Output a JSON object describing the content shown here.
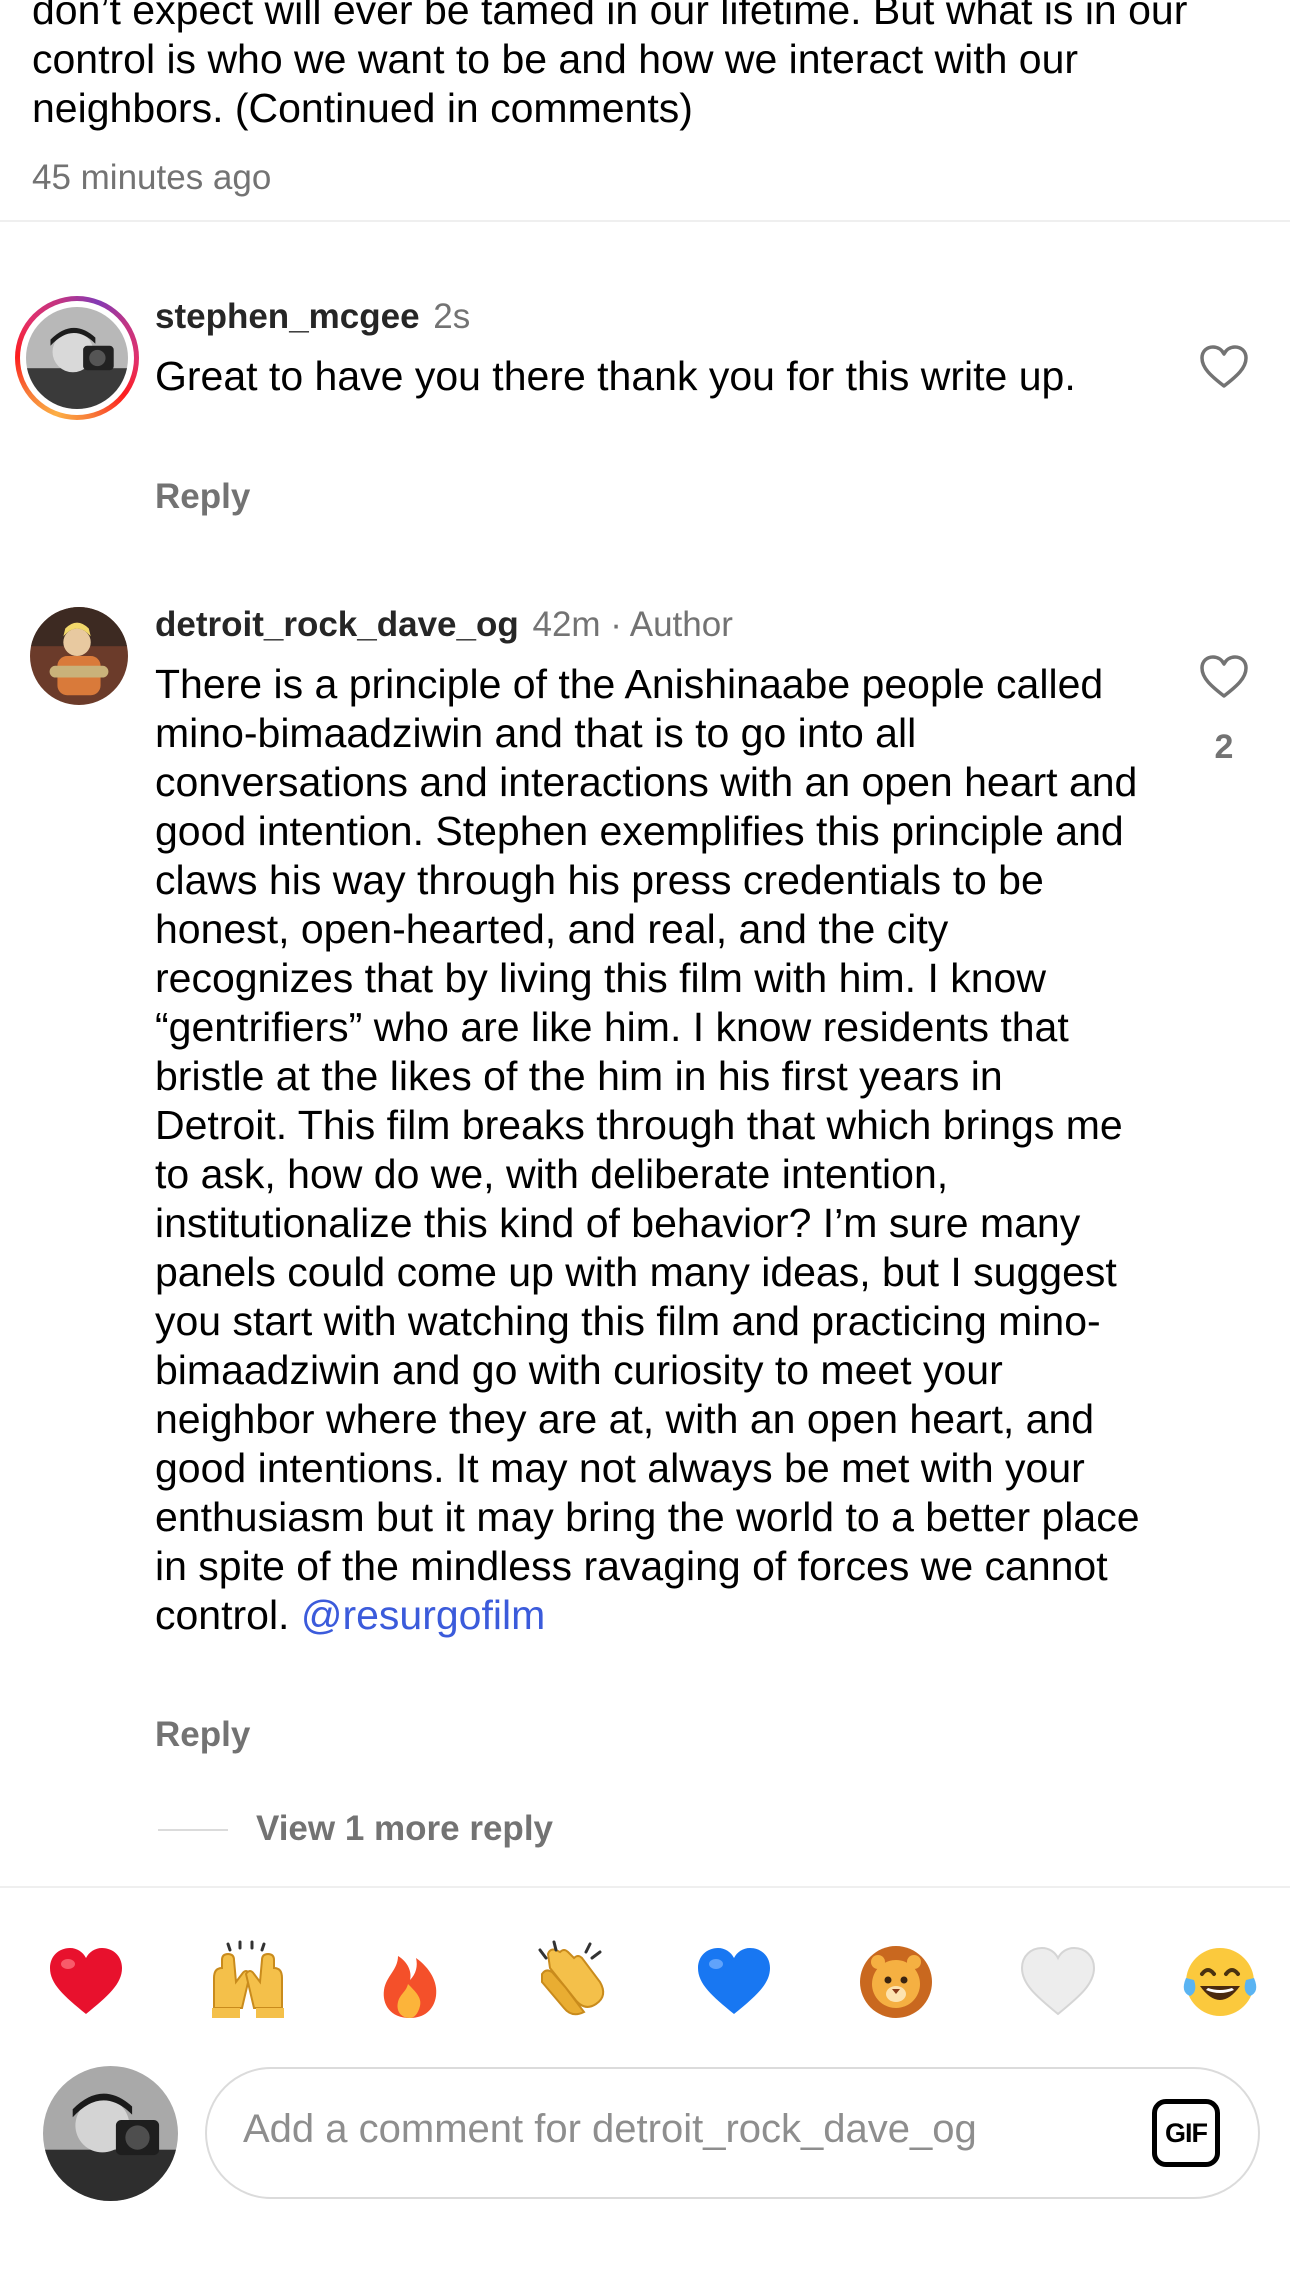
{
  "post": {
    "caption": "don’t expect will ever be tamed in our lifetime. But what is in our control is who we want to be and how we interact with our neighbors. (Continued in comments)",
    "time": "45 minutes ago"
  },
  "comments": [
    {
      "username": "stephen_mcgee",
      "meta": "2s",
      "text": "Great to have you there thank you for this write up.",
      "reply_label": "Reply"
    },
    {
      "username": "detroit_rock_dave_og",
      "meta": "42m · Author",
      "text": "There is a principle of the Anishinaabe people called mino-bimaadziwin and that is to go into all conversations and interactions with an open heart and good intention. Stephen exemplifies this principle and claws his way through his press credentials to be honest, open-hearted, and real, and the city recognizes that by living this film with him. I know “gentrifiers” who are like him. I know residents that bristle at the likes of the him in his first years in Detroit. This film breaks through that which brings me to ask, how do we, with deliberate intention, institutionalize this kind of behavior? I’m sure many panels could come up with many ideas, but I suggest you start with watching this film and practicing mino-bimaadziwin and go with curiosity to meet your neighbor where they are at, with an open heart, and good intentions. It may not always be met with your enthusiasm but it may bring the world to a better place in spite of the mindless ravaging of forces we cannot control. ",
      "mention": "@resurgofilm",
      "like_count": "2",
      "reply_label": "Reply",
      "more_replies": "View 1 more reply"
    }
  ],
  "reactions": [
    "red-heart",
    "raising-hands",
    "fire",
    "clapping-hands",
    "blue-heart",
    "lion",
    "white-heart",
    "tears-of-joy"
  ],
  "composer": {
    "placeholder": "Add a comment for detroit_rock_dave_og",
    "gif_label": "GIF"
  },
  "colors": {
    "secondary_text": "#737373",
    "mention": "#3b5bdb",
    "divider": "#efefef"
  }
}
